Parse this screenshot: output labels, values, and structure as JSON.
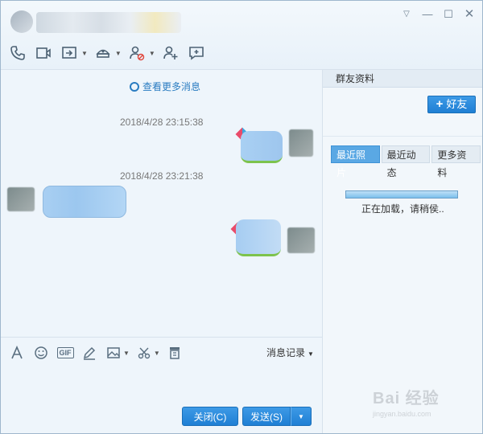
{
  "window": {
    "controls": {
      "down": "▽",
      "minimize": "—",
      "maximize": "☐",
      "close": "✕"
    }
  },
  "toolbar": {
    "icons": [
      "phone-icon",
      "video-icon",
      "share-screen-icon",
      "app-icon",
      "remove-member-icon",
      "add-member-icon",
      "add-discussion-icon"
    ]
  },
  "chat": {
    "more_messages": "查看更多消息",
    "timestamps": [
      "2018/4/28 23:15:38",
      "2018/4/28 23:21:38"
    ]
  },
  "input": {
    "tools": [
      "font-icon",
      "emoji-icon",
      "gif-icon",
      "pen-icon",
      "image-icon",
      "scissors-icon",
      "file-icon"
    ],
    "gif_label": "GIF",
    "history_label": "消息记录",
    "close_button": "关闭(C)",
    "send_button": "发送(S)"
  },
  "side": {
    "title": "群友资料",
    "add_friend": "好友",
    "tabs": [
      "最近照片",
      "最近动态",
      "更多资料"
    ],
    "loading_text": "正在加载，请稍侯..",
    "loading_progress": 1.0
  },
  "watermark": {
    "logo": "Bai 经验",
    "url": "jingyan.baidu.com"
  },
  "colors": {
    "accent": "#1f7fd4",
    "link": "#2a7cc1",
    "tab_active": "#5aa8e4"
  }
}
